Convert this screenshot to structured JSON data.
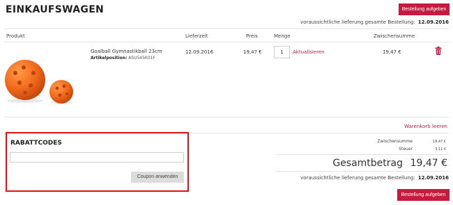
{
  "header": {
    "title": "EINKAUFSWAGEN",
    "checkout_label": "Bestellung aufgeben",
    "delivery_label": "voraussichtliche lieferung gesamte Bestellung:",
    "delivery_date": "12.09.2016"
  },
  "table": {
    "columns": [
      "Produkt",
      "Lieferzeit",
      "Preis",
      "Menge",
      "Zwischensumme"
    ],
    "row": {
      "name": "Goalball Gymnastikball 23cm",
      "sku_label": "Artikelposition:",
      "sku": "ASU545K01F",
      "delivery": "12.09.2016",
      "price": "19,47 €",
      "qty": "1",
      "update_label": "Aktualisieren",
      "subtotal": "19,47 €",
      "delete_icon": "trash-icon"
    }
  },
  "clear_cart_label": "Warenkorb leeren",
  "coupon": {
    "title": "RABATTCODES",
    "input_value": "",
    "button_label": "Coupon anwenden"
  },
  "summary": {
    "subtotal_label": "Zwischensumme",
    "subtotal_value": "19,47 €",
    "tax_label": "Steuer",
    "tax_value": "3,11 €",
    "total_label": "Gesamtbetrag",
    "total_value": "19,47 €"
  },
  "footer": {
    "delivery_label": "voraussichtliche lieferung gesamte Bestellung:",
    "delivery_date": "12.09.2016",
    "checkout_label": "Bestellung aufgeben"
  },
  "colors": {
    "accent": "#c51b3e",
    "highlight_border": "#e21010",
    "ball": "#f26a1b"
  }
}
